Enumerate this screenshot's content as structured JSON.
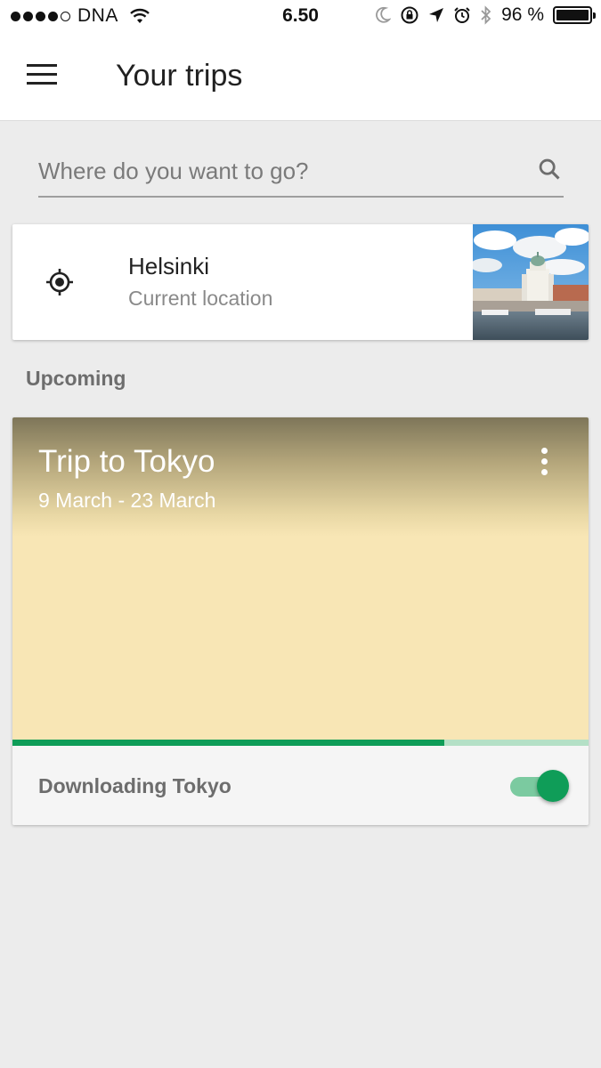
{
  "status_bar": {
    "carrier": "DNA",
    "time": "6.50",
    "battery_percent": "96 %",
    "signal_bars_filled": 4,
    "signal_bars_total": 5
  },
  "app_bar": {
    "title": "Your trips",
    "menu_icon": "hamburger-menu-icon"
  },
  "search": {
    "placeholder": "Where do you want to go?",
    "value": "",
    "icon": "search-icon"
  },
  "current_location": {
    "city": "Helsinki",
    "subtitle": "Current location",
    "icon": "my-location-icon"
  },
  "upcoming": {
    "header": "Upcoming",
    "trips": [
      {
        "title": "Trip to Tokyo",
        "dates": "9 March - 23 March",
        "download_label": "Downloading Tokyo",
        "download_progress": 0.75,
        "offline_enabled": true
      }
    ]
  },
  "colors": {
    "accent_green": "#0f9d58",
    "progress_track": "#b4e0c6",
    "trip_card_bg": "#f8e6b5",
    "app_background": "#ececec"
  }
}
